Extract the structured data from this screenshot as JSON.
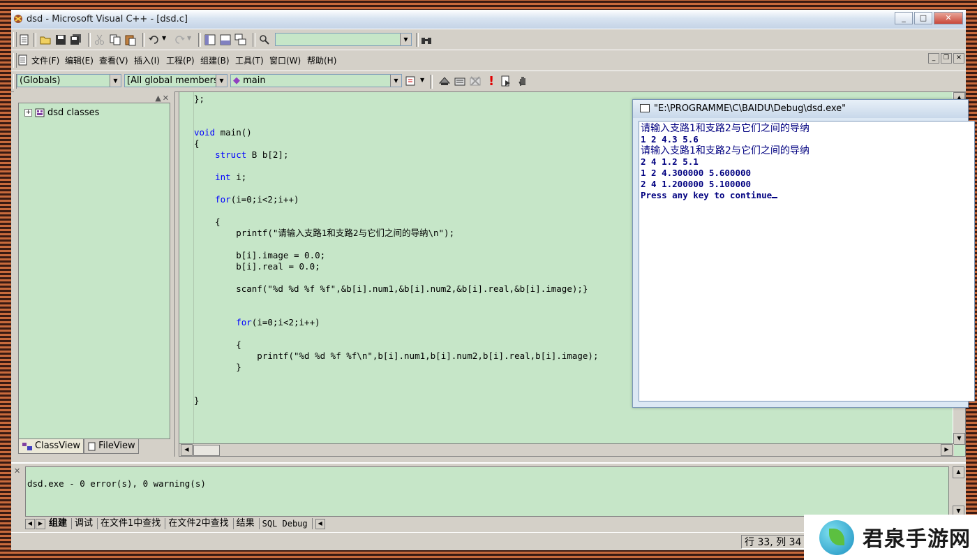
{
  "window": {
    "title": "dsd - Microsoft Visual C++ - [dsd.c]",
    "btn_min": "_",
    "btn_max": "□",
    "btn_close": "✕"
  },
  "menu": {
    "items": [
      "文件(F)",
      "编辑(E)",
      "查看(V)",
      "插入(I)",
      "工程(P)",
      "组建(B)",
      "工具(T)",
      "窗口(W)",
      "帮助(H)"
    ]
  },
  "wizardbar": {
    "scope": "(Globals)",
    "members": "[All global members",
    "function": "main"
  },
  "workspace": {
    "root_label": "dsd classes",
    "tab_classview": "ClassView",
    "tab_fileview": "FileView"
  },
  "editor": {
    "lines": [
      "};",
      "",
      "",
      "void main()",
      "{",
      "    struct B b[2];",
      "",
      "    int i;",
      "",
      "    for(i=0;i<2;i++)",
      "",
      "    {",
      "        printf(\"请输入支路1和支路2与它们之间的导纳\\n\");",
      "",
      "        b[i].image = 0.0;",
      "        b[i].real = 0.0;",
      "",
      "        scanf(\"%d %d %f %f\",&b[i].num1,&b[i].num2,&b[i].real,&b[i].image);}",
      "",
      "",
      "        for(i=0;i<2;i++)",
      "",
      "        {",
      "            printf(\"%d %d %f %f\\n\",b[i].num1,b[i].num2,b[i].real,b[i].image);",
      "        }",
      "",
      "",
      "}"
    ]
  },
  "console": {
    "title": "\"E:\\PROGRAMME\\C\\BAIDU\\Debug\\dsd.exe\"",
    "lines": [
      "请输入支路1和支路2与它们之间的导纳",
      "1 2 4.3 5.6",
      "请输入支路1和支路2与它们之间的导纳",
      "2 4 1.2 5.1",
      "1 2 4.300000 5.600000",
      "2 4 1.200000 5.100000",
      "Press any key to continue"
    ]
  },
  "output": {
    "text": "dsd.exe - 0 error(s), 0 warning(s)",
    "tabs": [
      "组建",
      "调试",
      "在文件1中查找",
      "在文件2中查找",
      "结果",
      "SQL Debug"
    ]
  },
  "status": {
    "position": "行 33, 列 34"
  },
  "watermark": {
    "text": "君泉手游网"
  }
}
